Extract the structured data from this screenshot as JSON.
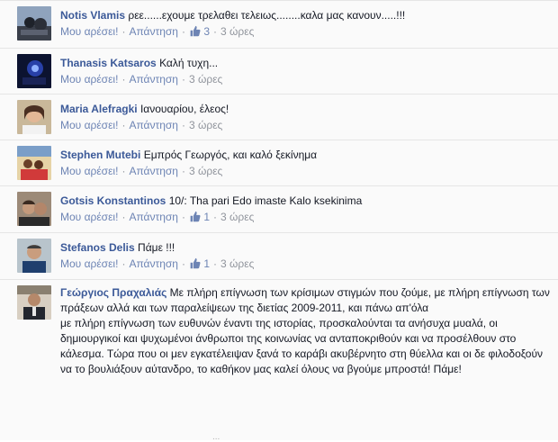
{
  "comments": [
    {
      "author": "Notis Vlamis",
      "text": "ρεε......εχουμε τρελαθει τελειως........καλα μας κανουν.....!!!",
      "like_label": "Μου αρέσει!",
      "reply_label": "Απάντηση",
      "likes": "3",
      "time": "3 ώρες"
    },
    {
      "author": "Thanasis Katsaros",
      "text": "Καλή τυχη...",
      "like_label": "Μου αρέσει!",
      "reply_label": "Απάντηση",
      "time": "3 ώρες"
    },
    {
      "author": "Maria Alefragki",
      "text": "Ιανουαρίου, έλεος!",
      "like_label": "Μου αρέσει!",
      "reply_label": "Απάντηση",
      "time": "3 ώρες"
    },
    {
      "author": "Stephen Mutebi",
      "text": "Εμπρός Γεωργός, και καλό ξεκίνημα",
      "like_label": "Μου αρέσει!",
      "reply_label": "Απάντηση",
      "time": "3 ώρες"
    },
    {
      "author": "Gotsis Konstantinos",
      "text": "10/: Tha pari Edo imaste Kalo ksekinima",
      "like_label": "Μου αρέσει!",
      "reply_label": "Απάντηση",
      "likes": "1",
      "time": "3 ώρες"
    },
    {
      "author": "Stefanos Delis",
      "text": "Πάμε !!!",
      "like_label": "Μου αρέσει!",
      "reply_label": "Απάντηση",
      "likes": "1",
      "time": "3 ώρες"
    },
    {
      "author": "Γεώργιος Πραχαλιάς",
      "text_intro": "Με πλήρη επίγνωση των κρίσιμων στιγμών που ζούμε, με πλήρη επίγνωση των πράξεων αλλά και των παραλείψεων της διετίας 2009-2011, και πάνω απ'όλα",
      "text_body": "με πλήρη επίγνωση των ευθυνών έναντι της ιστορίας, προσκαλούνται τα ανήσυχα μυαλά, οι δημιουργικοί και ψυχωμένοι άνθρωποι της κοινωνίας να ανταποκριθούν και να προσέλθουν στο κάλεσμα. Τώρα που οι μεν εγκατέλειψαν ξανά το καράβι ακυβέρνητο στη θύελλα και οι δε φιλοδοξούν να το βουλιάξουν αύτανδρο, το καθήκον μας καλεί όλους να βγούμε μπροστά! Πάμε!",
      "more": "..."
    }
  ],
  "colors": {
    "author": "#3b5998",
    "link": "#6d84b4",
    "muted": "#90949c",
    "background": "#fafafa",
    "divider": "#e5e5e5"
  },
  "icons": {
    "like": "thumbs-up-icon"
  }
}
